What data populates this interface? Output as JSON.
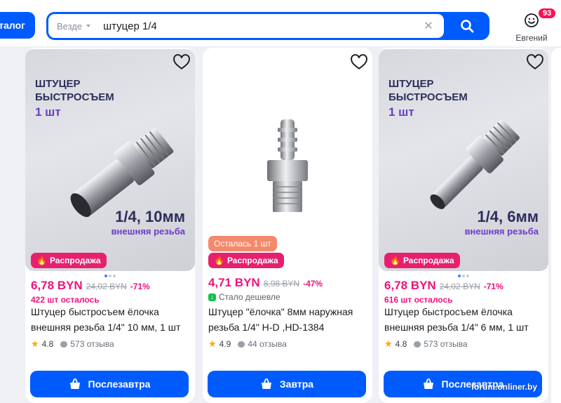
{
  "header": {
    "catalog_label": "талог",
    "search_scope": "Везде",
    "search_query": "штуцер 1/4",
    "clear_symbol": "✕",
    "user_name": "Евгений",
    "notif_count": "93"
  },
  "colors": {
    "accent": "#005bff",
    "price": "#f1117e",
    "sale": "#e6206f",
    "rating_star": "#ffa800"
  },
  "cards": [
    {
      "promo_title": "ШТУЦЕР\nБЫСТРОСЪЕМ",
      "promo_qty": "1 шт",
      "promo_size": "1/4, 10мм",
      "promo_thread": "внешняя резьба",
      "stock_chip": "",
      "sale_chip": "Распродажа",
      "price": "6,78 BYN",
      "old_price": "24,02 BYN",
      "discount": "-71%",
      "stock_left": "422 шт осталось",
      "title": "Штуцер быстросъем ёлочка внешняя резьба 1/4\" 10 мм, 1 шт",
      "rating": "4.8",
      "reviews": "573 отзыва",
      "button": "Послезавтра"
    },
    {
      "stock_chip": "Осталась 1 шт",
      "sale_chip": "Распродажа",
      "price": "4,71 BYN",
      "old_price": "8,98 BYN",
      "discount": "-47%",
      "cheaper_label": "Стало дешевле",
      "title": "Штуцер \"ёлочка\" 8мм наружная резьба 1/4\" H-D ,HD-1384",
      "rating": "4.9",
      "reviews": "44 отзыва",
      "button": "Завтра"
    },
    {
      "promo_title": "ШТУЦЕР\nБЫСТРОСЪЕМ",
      "promo_qty": "1 шт",
      "promo_size": "1/4, 6мм",
      "promo_thread": "внешняя резьба",
      "sale_chip": "Распродажа",
      "price": "6,78 BYN",
      "old_price": "24,02 BYN",
      "discount": "-71%",
      "stock_left": "616 шт осталось",
      "title": "Штуцер быстросъем ёлочка внешняя резьба 1/4\" 6 мм, 1 шт",
      "rating": "4.8",
      "reviews": "573 отзыва",
      "button": "Послезавтра"
    }
  ],
  "watermark": "forum.onliner.by"
}
